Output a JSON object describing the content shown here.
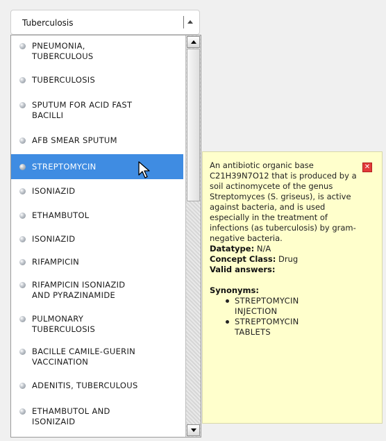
{
  "search": {
    "value": "Tuberculosis",
    "toggle_icon": "up-arrow-icon"
  },
  "list": {
    "selected_index": 4,
    "items": [
      {
        "label": "PNEUMONIA,\nTUBERCULOUS"
      },
      {
        "label": "TUBERCULOSIS"
      },
      {
        "label": "SPUTUM FOR ACID FAST\nBACILLI"
      },
      {
        "label": "AFB SMEAR SPUTUM"
      },
      {
        "label": "STREPTOMYCIN"
      },
      {
        "label": "ISONIAZID"
      },
      {
        "label": "ETHAMBUTOL"
      },
      {
        "label": "ISONIAZID"
      },
      {
        "label": "RIFAMPICIN"
      },
      {
        "label": "RIFAMPICIN ISONIAZID\nAND PYRAZINAMIDE"
      },
      {
        "label": "PULMONARY\nTUBERCULOSIS"
      },
      {
        "label": "BACILLE CAMILE-GUERIN\nVACCINATION"
      },
      {
        "label": "ADENITIS, TUBERCULOUS"
      },
      {
        "label": "ETHAMBUTOL AND\nISONIZAID"
      }
    ]
  },
  "tooltip": {
    "description": "An antibiotic organic base C21H39N7O12 that is produced by a soil actinomycete of the genus Streptomyces (S. griseus), is active against bacteria, and is used especially in the treatment of infections (as tuberculosis) by gram-negative bacteria.",
    "datatype_label": "Datatype:",
    "datatype_value": "N/A",
    "concept_class_label": "Concept Class:",
    "concept_class_value": "Drug",
    "valid_answers_label": "Valid answers:",
    "synonyms_label": "Synonyms:",
    "synonyms": [
      "STREPTOMYCIN\nINJECTION",
      "STREPTOMYCIN\nTABLETS"
    ],
    "close_icon": "close-icon",
    "close_glyph": "✕"
  },
  "colors": {
    "selected_bg": "#3f8ce2",
    "tooltip_bg": "#ffffcc",
    "close_red": "#e23a3a"
  }
}
